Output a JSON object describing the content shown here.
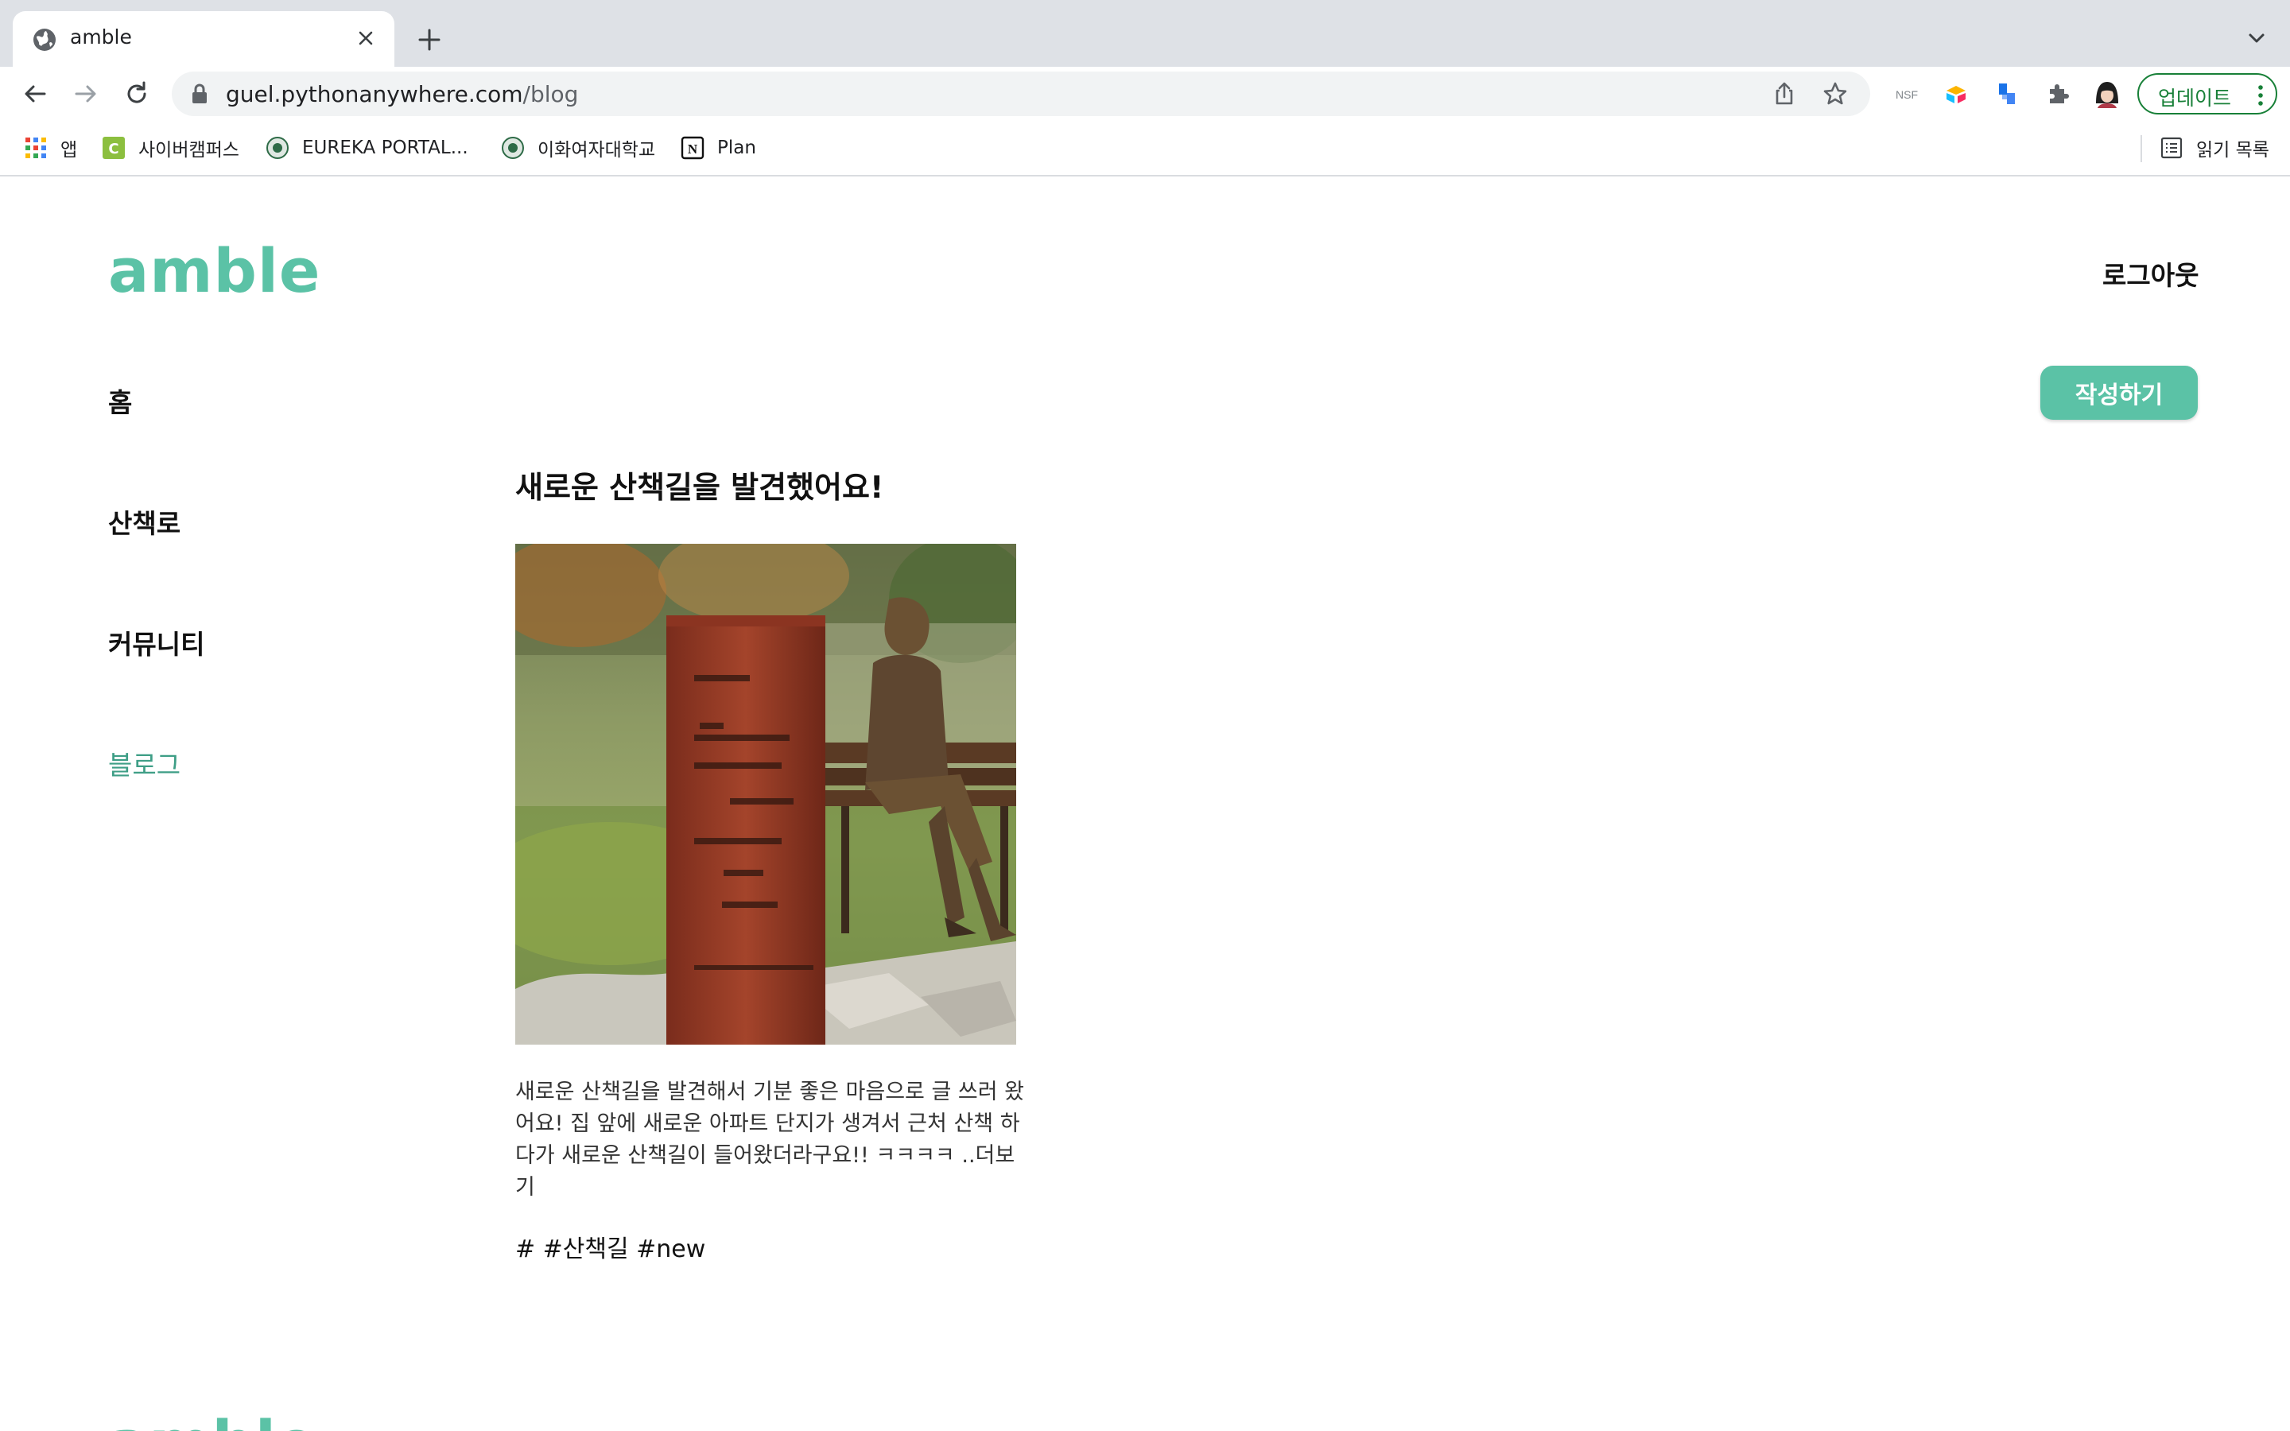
{
  "browser": {
    "tab_title": "amble",
    "url_host": "guel.pythonanywhere.com",
    "url_path": "/blog",
    "update_label": "업데이트",
    "bookmarks": [
      "앱",
      "사이버캠퍼스",
      "EUREKA PORTAL...",
      "이화여자대학교",
      "Plan"
    ],
    "reading_list": "읽기 목록",
    "extension_nsf": "NSF"
  },
  "header": {
    "logo": "amble",
    "logout": "로그아웃"
  },
  "sidebar": {
    "items": [
      {
        "label": "홈"
      },
      {
        "label": "산책로"
      },
      {
        "label": "커뮤니티"
      },
      {
        "label": "블로그",
        "active": true
      }
    ]
  },
  "actions": {
    "write": "작성하기"
  },
  "post": {
    "title": "새로운 산책길을 발견했어요!",
    "body": "새로운 산책길을 발견해서 기분 좋은 마음으로 글 쓰러 왔어요! 집 앞에 새로운 아파트 단지가 생겨서 근처 산책 하다가 새로운 산책길이 들어왔더라구요!! ㅋㅋㅋㅋ ..더보기",
    "tags": "# #산책길 #new"
  },
  "footer": {
    "logo": "amble"
  },
  "colors": {
    "accent": "#5bc2a6",
    "active_nav": "#3e9e86"
  }
}
